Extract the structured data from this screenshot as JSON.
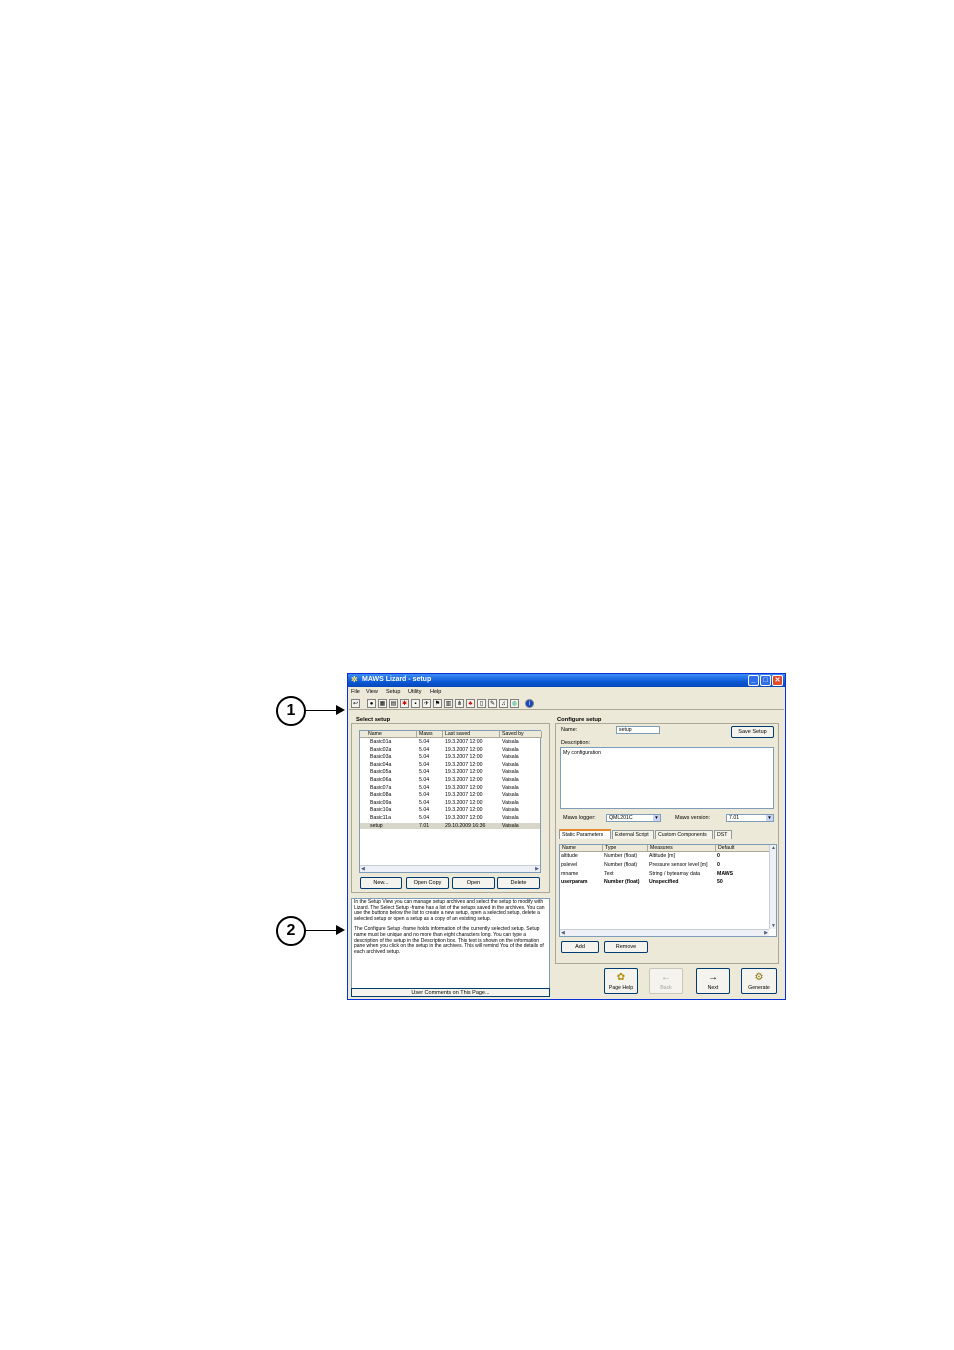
{
  "callouts": [
    "1",
    "2"
  ],
  "window": {
    "title": "MAWS Lizard - setup",
    "icon": "lizard-icon",
    "menu": [
      "File",
      "View",
      "Setup",
      "Utility",
      "Help"
    ],
    "toolbar_icons": [
      "back-icon",
      "record-icon",
      "grid-icon",
      "table-icon",
      "sensor-icon",
      "disk-icon",
      "plane-icon",
      "flag-icon",
      "chart-icon",
      "tree-icon",
      "network-icon",
      "page-icon",
      "pen-icon",
      "bell-icon",
      "globe-icon",
      "info-icon"
    ]
  },
  "select_setup": {
    "title": "Select setup",
    "columns": [
      "Name",
      "Maws",
      "Last saved",
      "Saved by"
    ],
    "rows": [
      [
        "Basic01a",
        "5.04",
        "19.3.2007 12:00",
        "Vaisala"
      ],
      [
        "Basic02a",
        "5.04",
        "19.3.2007 12:00",
        "Vaisala"
      ],
      [
        "Basic03a",
        "5.04",
        "19.3.2007 12:00",
        "Vaisala"
      ],
      [
        "Basic04a",
        "5.04",
        "19.3.2007 12:00",
        "Vaisala"
      ],
      [
        "Basic05a",
        "5.04",
        "19.3.2007 12:00",
        "Vaisala"
      ],
      [
        "Basic06a",
        "5.04",
        "19.3.2007 12:00",
        "Vaisala"
      ],
      [
        "Basic07a",
        "5.04",
        "19.3.2007 12:00",
        "Vaisala"
      ],
      [
        "Basic08a",
        "5.04",
        "19.3.2007 12:00",
        "Vaisala"
      ],
      [
        "Basic09a",
        "5.04",
        "19.3.2007 12:00",
        "Vaisala"
      ],
      [
        "Basic10a",
        "5.04",
        "19.3.2007 12:00",
        "Vaisala"
      ],
      [
        "Basic11a",
        "5.04",
        "19.3.2007 12:00",
        "Vaisala"
      ],
      [
        "setup",
        "7.01",
        "29.10.2009 16:36",
        "Vaisala"
      ]
    ],
    "selected_row": 11,
    "buttons": {
      "new": "New...",
      "open_copy": "Open Copy",
      "open": "Open",
      "delete": "Delete"
    }
  },
  "help_pane": {
    "paragraph1": "In the Setup View you can manage setup archives and select the setup to modify with Lizard. The Select Setup -frame has a list of the setups saved in the archives. You can use the buttons below the list to create a new setup, open a selected setup, delete a selected setup or open a setup as a copy of an existing setup.",
    "paragraph2": "The Configure Setup -frame holds information of the currently selected setup. Setup name must be unique and no more than eight characters long. You can type a description of the setup in the Description box. This text is shown on the information pane when you click on the setup in the archives. This will remind You of the details of each archived setup.",
    "comments_button": "User Comments on This Page..."
  },
  "configure_setup": {
    "title": "Configure setup",
    "name_label": "Name:",
    "name_value": "setup",
    "save_button": "Save Setup",
    "description_label": "Description:",
    "description_value": "My configuration",
    "logger_label": "Maws logger:",
    "logger_value": "QML201C",
    "version_label": "Maws version:",
    "version_value": "7.01",
    "tabs": [
      "Static Parameters",
      "External Script",
      "Custom Components",
      "DST"
    ],
    "active_tab": 0,
    "param_columns": [
      "Name",
      "Type",
      "Measures",
      "Default"
    ],
    "params": [
      [
        "altitude",
        "Number (float)",
        "Altitude [m]",
        "0"
      ],
      [
        "pslevel",
        "Number (float)",
        "Pressure sensor level [m]",
        "0"
      ],
      [
        "mname",
        "Text",
        "String / bytearray data",
        "MAWS"
      ],
      [
        "userparam",
        "Number (float)",
        "Unspecified",
        "50"
      ]
    ],
    "add_button": "Add",
    "remove_button": "Remove"
  },
  "nav": {
    "page_help": "Page Help",
    "back": "Back",
    "next": "Next",
    "generate": "Generate"
  }
}
